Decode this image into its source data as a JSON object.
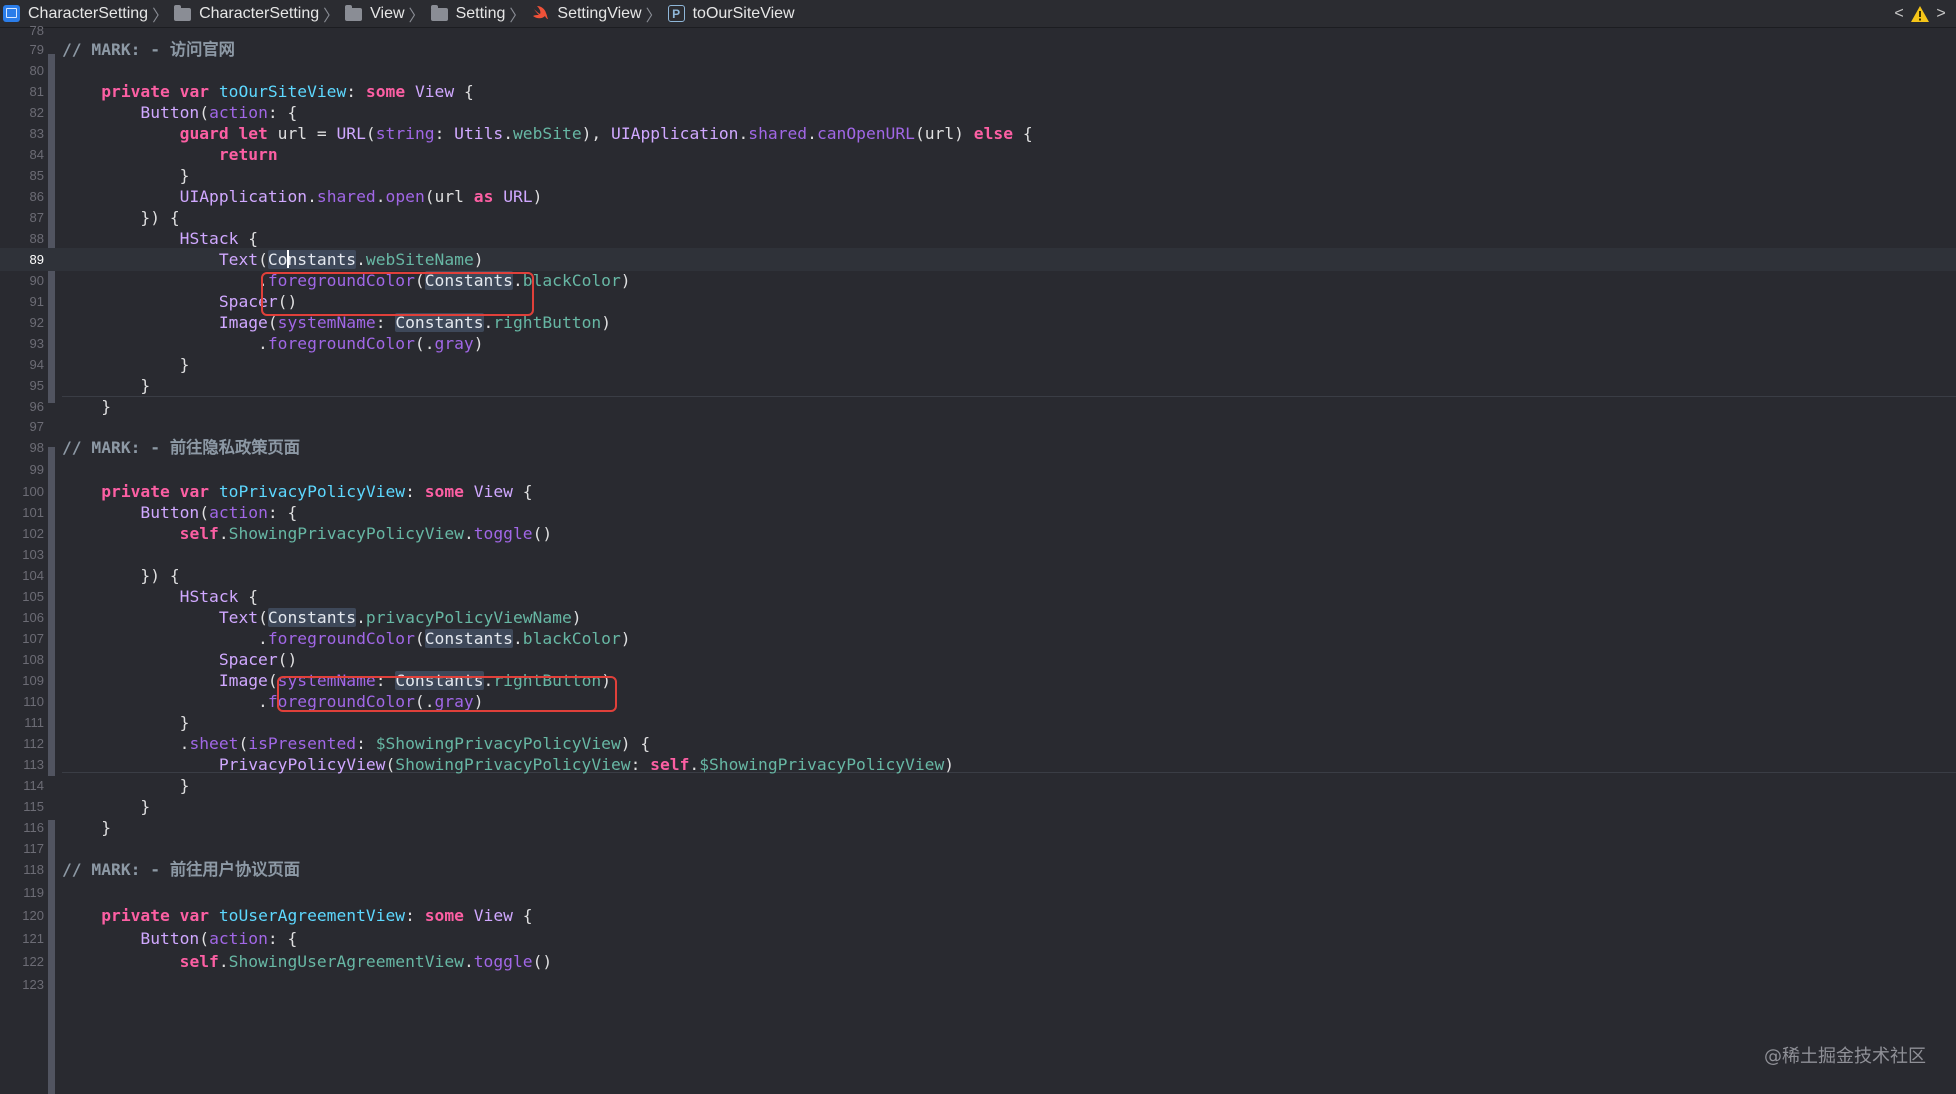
{
  "breadcrumb": {
    "project": "CharacterSetting",
    "folder1": "CharacterSetting",
    "folder2": "View",
    "folder3": "Setting",
    "file": "SettingView",
    "symbol": "toOurSiteView"
  },
  "symbol_badge": "P",
  "nav": {
    "back": "<",
    "forward": ">"
  },
  "editor": {
    "current_line": 89,
    "line_numbers": [
      "78",
      "79",
      "80",
      "81",
      "82",
      "83",
      "84",
      "85",
      "86",
      "87",
      "88",
      "89",
      "90",
      "91",
      "92",
      "93",
      "94",
      "95",
      "96",
      "97",
      "98",
      "99",
      "100",
      "101",
      "102",
      "103",
      "104",
      "105",
      "106",
      "107",
      "108",
      "109",
      "110",
      "111",
      "112",
      "113",
      "114",
      "115",
      "116",
      "117",
      "118",
      "119",
      "120",
      "121",
      "122",
      "123"
    ],
    "marks": {
      "mark1": "// MARK: - 访问官网",
      "mark2": "// MARK: - 前往隐私政策页面",
      "mark3": "// MARK: - 前往用户协议页面"
    }
  },
  "colors": {
    "background": "#292a30",
    "keyword": "#fc5fa3",
    "declaration": "#5dd8ff",
    "type": "#d0a8ff",
    "comment": "#7f8c98",
    "highlight_box": "#e0403a"
  },
  "watermark": "@稀土掘金技术社区"
}
